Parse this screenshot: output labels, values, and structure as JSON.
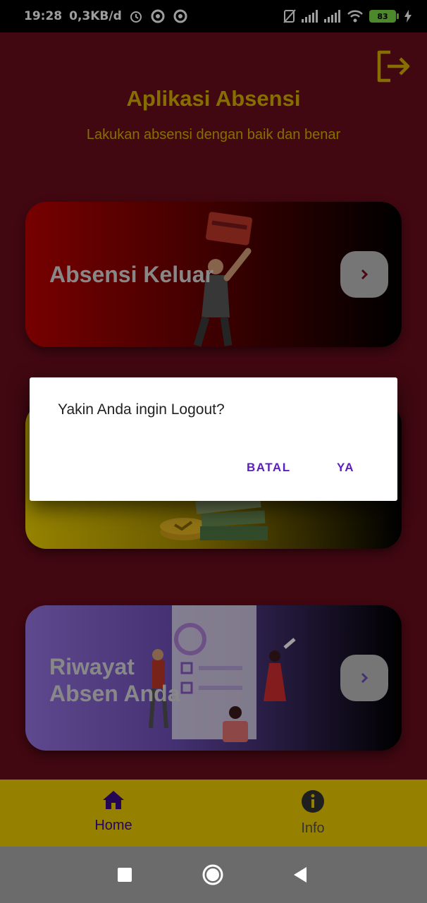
{
  "status_bar": {
    "time": "19:28",
    "net_speed": "0,3KB/d",
    "battery_level": "83",
    "icons": [
      "alarm-icon",
      "data-saver-icon",
      "data-saver-icon",
      "no-sim-icon",
      "signal-icon",
      "signal-icon",
      "wifi-icon",
      "battery-icon",
      "charging-icon"
    ]
  },
  "header": {
    "title": "Aplikasi Absensi",
    "subtitle": "Lakukan absensi dengan baik dan benar",
    "logout_icon": "logout-icon"
  },
  "cards": [
    {
      "title": "Absensi Keluar",
      "arrow_icon": "chevron-right-icon",
      "accent": "#c00000"
    },
    {
      "title": "",
      "arrow_icon": "chevron-right-icon",
      "accent": "#f1d300"
    },
    {
      "title": "Riwayat Absen Anda",
      "arrow_icon": "chevron-right-icon",
      "accent": "#9a76e6"
    }
  ],
  "dialog": {
    "message": "Yakin Anda ingin Logout?",
    "cancel_label": "BATAL",
    "confirm_label": "YA",
    "button_color": "#5b1fbf"
  },
  "bottom_nav": {
    "items": [
      {
        "label": "Home",
        "icon": "home-icon",
        "active": true
      },
      {
        "label": "Info",
        "icon": "info-icon",
        "active": false
      }
    ],
    "background": "#f3cf00"
  },
  "system_nav": {
    "buttons": [
      "recent-apps-icon",
      "home-circle-icon",
      "back-icon"
    ]
  },
  "colors": {
    "app_background": "#6a0d1c",
    "title_color": "#d8b400"
  }
}
